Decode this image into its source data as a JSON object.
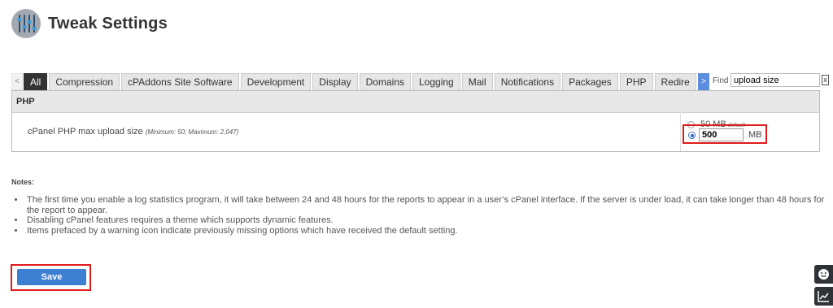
{
  "header": {
    "title": "Tweak Settings",
    "logo_icon": "sliders-icon"
  },
  "tabs": {
    "scroll_left": "<",
    "scroll_right": ">",
    "items": [
      {
        "label": "All",
        "active": true
      },
      {
        "label": "Compression"
      },
      {
        "label": "cPAddons Site Software"
      },
      {
        "label": "Development"
      },
      {
        "label": "Display"
      },
      {
        "label": "Domains"
      },
      {
        "label": "Logging"
      },
      {
        "label": "Mail"
      },
      {
        "label": "Notifications"
      },
      {
        "label": "Packages"
      },
      {
        "label": "PHP"
      },
      {
        "label": "Redire"
      }
    ]
  },
  "find": {
    "label": "Find",
    "value": "upload size",
    "clear": "x"
  },
  "section": {
    "title": "PHP",
    "setting": {
      "label": "cPanel PHP max upload size",
      "range": "(Minimum: 50; Maximum: 2,047)",
      "default_option": {
        "value": "50 MB",
        "tag": "default",
        "selected": false
      },
      "custom_option": {
        "value": "500",
        "unit": "MB",
        "selected": true
      }
    }
  },
  "notes": {
    "title": "Notes:",
    "items": [
      "The first time you enable a log statistics program, it will take between 24 and 48 hours for the reports to appear in a user’s cPanel interface. If the server is under load, it can take longer than 48 hours for the report to appear.",
      "Disabling cPanel features requires a theme which supports dynamic features.",
      "Items prefaced by a warning icon indicate previously missing options which have received the default setting."
    ]
  },
  "actions": {
    "save_label": "Save"
  },
  "side_buttons": [
    {
      "icon": "smiley-icon"
    },
    {
      "icon": "trend-chart-icon"
    }
  ],
  "colors": {
    "active_tab": "#333333",
    "accent_blue": "#3d7fd0",
    "highlight_red": "#e01b1b"
  }
}
